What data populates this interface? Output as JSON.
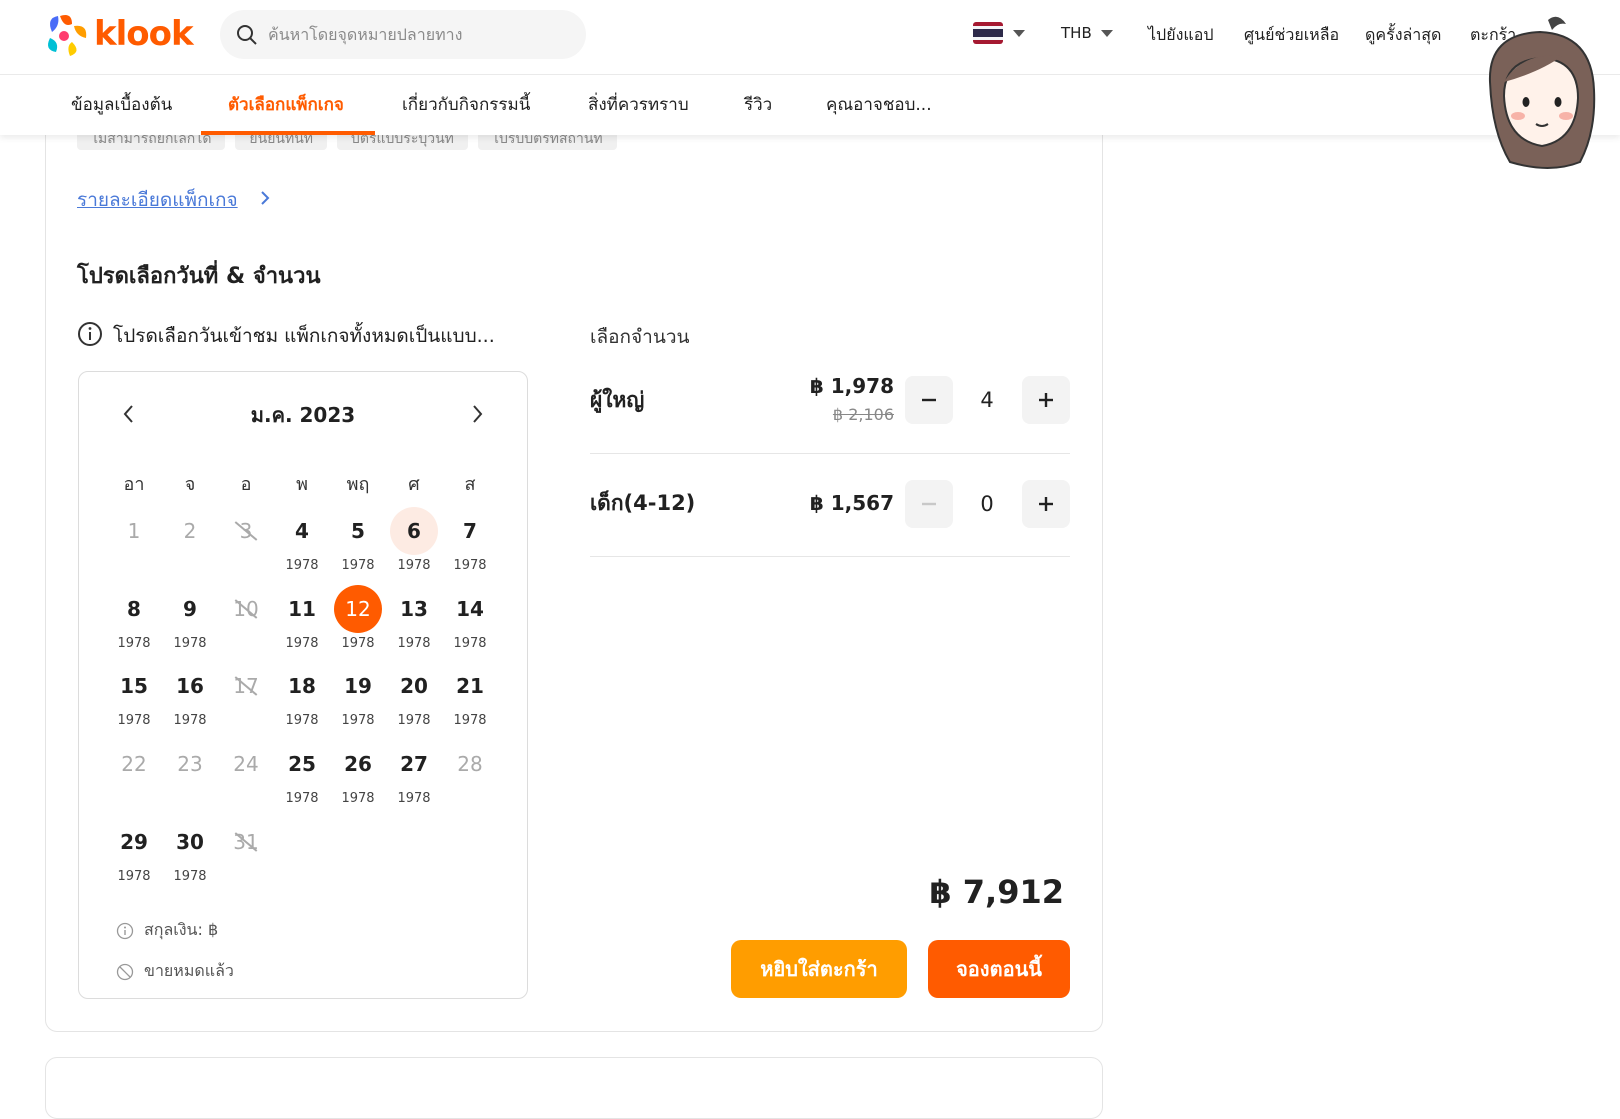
{
  "header": {
    "logo_text": "klook",
    "search_placeholder": "ค้นหาโดยจุดหมายปลายทาง",
    "currency": "THB",
    "links": [
      "ไปยังแอป",
      "ศูนย์ช่วยเหลือ",
      "ดูครั้งล่าสุด",
      "ตะกร้า"
    ]
  },
  "tabs": [
    "ข้อมูลเบื้องต้น",
    "ตัวเลือกแพ็กเกจ",
    "เกี่ยวกับกิจกรรมนี้",
    "สิ่งที่ควรทราบ",
    "รีวิว",
    "คุณอาจชอบ..."
  ],
  "active_tab": "ตัวเลือกแพ็กเกจ",
  "package": {
    "chips": [
      "ไม่สามารถยกเลิกได้",
      "ยืนยันทันที",
      "บัตรแบบระบุวันที่",
      "ไปรับบัตรที่สถานที่"
    ],
    "detail_link": "รายละเอียดแพ็กเกจ",
    "section_title": "โปรดเลือกวันที่ & จำนวน",
    "note": "โปรดเลือกวันเข้าชม แพ็กเกจทั้งหมดเป็นแบบ..."
  },
  "calendar": {
    "month_label": "ม.ค. 2023",
    "weekdays": [
      "อา",
      "จ",
      "อ",
      "พ",
      "พฤ",
      "ศ",
      "ส"
    ],
    "days": [
      {
        "d": "1",
        "p": "",
        "s": "past"
      },
      {
        "d": "2",
        "p": "",
        "s": "past"
      },
      {
        "d": "3",
        "p": "",
        "s": "sold"
      },
      {
        "d": "4",
        "p": "1978",
        "s": ""
      },
      {
        "d": "5",
        "p": "1978",
        "s": ""
      },
      {
        "d": "6",
        "p": "1978",
        "s": "today"
      },
      {
        "d": "7",
        "p": "1978",
        "s": ""
      },
      {
        "d": "8",
        "p": "1978",
        "s": ""
      },
      {
        "d": "9",
        "p": "1978",
        "s": ""
      },
      {
        "d": "10",
        "p": "",
        "s": "sold"
      },
      {
        "d": "11",
        "p": "1978",
        "s": ""
      },
      {
        "d": "12",
        "p": "1978",
        "s": "selected"
      },
      {
        "d": "13",
        "p": "1978",
        "s": ""
      },
      {
        "d": "14",
        "p": "1978",
        "s": ""
      },
      {
        "d": "15",
        "p": "1978",
        "s": ""
      },
      {
        "d": "16",
        "p": "1978",
        "s": ""
      },
      {
        "d": "17",
        "p": "",
        "s": "sold"
      },
      {
        "d": "18",
        "p": "1978",
        "s": ""
      },
      {
        "d": "19",
        "p": "1978",
        "s": ""
      },
      {
        "d": "20",
        "p": "1978",
        "s": ""
      },
      {
        "d": "21",
        "p": "1978",
        "s": ""
      },
      {
        "d": "22",
        "p": "",
        "s": "past"
      },
      {
        "d": "23",
        "p": "",
        "s": "past"
      },
      {
        "d": "24",
        "p": "",
        "s": "past"
      },
      {
        "d": "25",
        "p": "1978",
        "s": ""
      },
      {
        "d": "26",
        "p": "1978",
        "s": ""
      },
      {
        "d": "27",
        "p": "1978",
        "s": ""
      },
      {
        "d": "28",
        "p": "",
        "s": "past"
      },
      {
        "d": "29",
        "p": "1978",
        "s": ""
      },
      {
        "d": "30",
        "p": "1978",
        "s": ""
      },
      {
        "d": "31",
        "p": "",
        "s": "sold"
      }
    ],
    "legend_currency": "สกุลเงิน: ฿",
    "legend_soldout": "ขายหมดแล้ว"
  },
  "quantity": {
    "title": "เลือกจำนวน",
    "adult": {
      "label": "ผู้ใหญ่",
      "price": "฿ 1,978",
      "old_price": "฿ 2,106",
      "count": "4"
    },
    "child": {
      "label": "เด็ก(4-12)",
      "price": "฿ 1,567",
      "count": "0"
    }
  },
  "total": "฿ 7,912",
  "buttons": {
    "add_to_cart": "หยิบใส่ตะกร้า",
    "book_now": "จองตอนนี้"
  },
  "colors": {
    "accent": "#ff5b00",
    "cart": "#ff9d00"
  }
}
